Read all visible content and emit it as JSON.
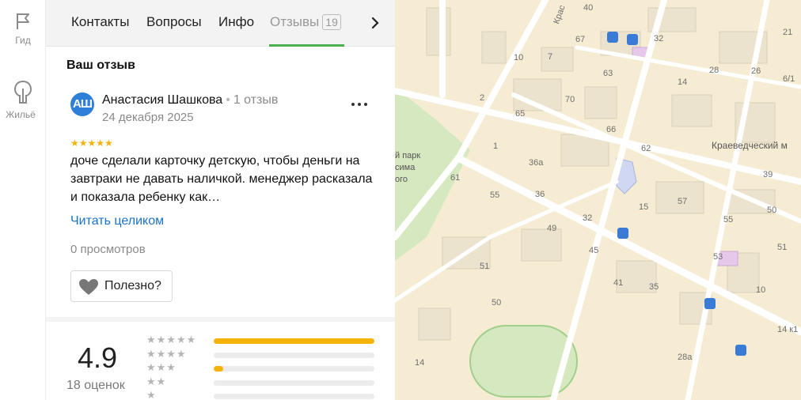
{
  "rail": {
    "items": [
      {
        "label": "Гид",
        "icon": "flag-icon"
      },
      {
        "label": "Жильё",
        "icon": "house-icon"
      }
    ]
  },
  "tabs": [
    {
      "label": "Контакты",
      "active": false
    },
    {
      "label": "Вопросы",
      "active": false
    },
    {
      "label": "Инфо",
      "active": false
    },
    {
      "label": "Отзывы",
      "active": true,
      "badge": "19"
    }
  ],
  "review_section": {
    "title": "Ваш отзыв",
    "author": {
      "initials": "АШ",
      "name": "Анастасия Шашкова",
      "reviews_count": "1 отзыв",
      "avatar_color": "#2f7ed8"
    },
    "date": "24 декабря 2025",
    "rating": 5,
    "stars_text": "★★★★★",
    "text": "доче сделали карточку детскую, чтобы деньги на завтраки не давать наличкой. менеджер расказала и показала ребенку как…",
    "read_more": "Читать целиком",
    "views": "0 просмотров",
    "useful_label": "Полезно?"
  },
  "rating_summary": {
    "value": "4.9",
    "count": "18 оценок",
    "distribution": [
      {
        "stars": "★★★★★",
        "fraction": 1.0
      },
      {
        "stars": "★★★★",
        "fraction": 0.0
      },
      {
        "stars": "★★★",
        "fraction": 0.06
      },
      {
        "stars": "★★",
        "fraction": 0.0
      },
      {
        "stars": "★",
        "fraction": 0.0
      }
    ],
    "accent_color": "#f5b30a"
  },
  "map": {
    "street_label": "Крас",
    "poi_labels": [
      "Краеведческий м",
      "й парк",
      "сима",
      "ого"
    ],
    "house_numbers": [
      "40",
      "32",
      "21",
      "67",
      "10",
      "7",
      "63",
      "14",
      "28",
      "26",
      "6/1",
      "2",
      "70",
      "65",
      "66",
      "62",
      "1",
      "36а",
      "36",
      "61",
      "55",
      "32",
      "15",
      "57",
      "55",
      "50",
      "39",
      "49",
      "45",
      "51",
      "53",
      "51",
      "41",
      "35",
      "10",
      "50",
      "14 к1",
      "28а",
      "14"
    ]
  }
}
